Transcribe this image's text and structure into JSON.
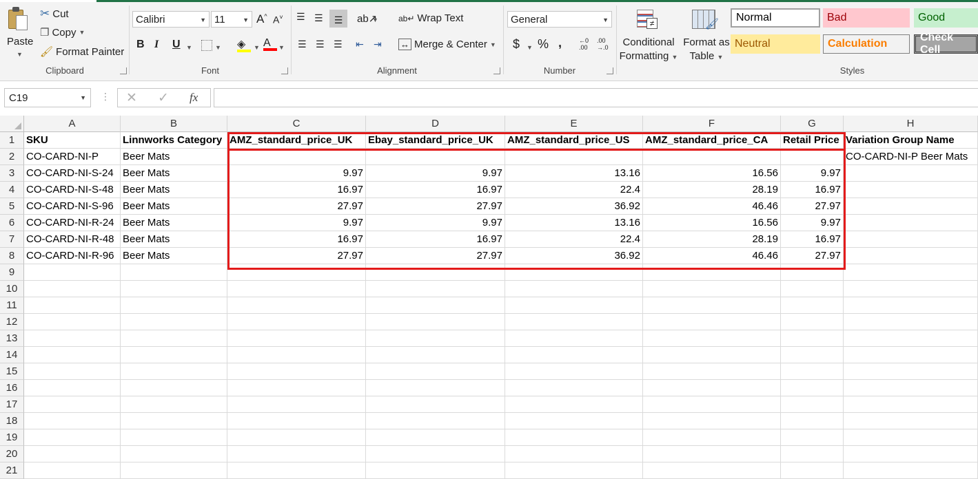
{
  "clipboard": {
    "paste": "Paste",
    "cut": "Cut",
    "copy": "Copy",
    "format_painter": "Format Painter",
    "label": "Clipboard"
  },
  "font": {
    "family": "Calibri",
    "size": "11",
    "label": "Font"
  },
  "alignment": {
    "wrap_text": "Wrap Text",
    "merge_center": "Merge & Center",
    "label": "Alignment"
  },
  "number": {
    "format": "General",
    "label": "Number"
  },
  "styles": {
    "conditional_formatting": [
      "Conditional",
      "Formatting"
    ],
    "format_as_table": [
      "Format as",
      "Table"
    ],
    "cells": [
      {
        "name": "Normal",
        "bg": "#ffffff",
        "fg": "#000000"
      },
      {
        "name": "Bad",
        "bg": "#ffc7ce",
        "fg": "#9c0006"
      },
      {
        "name": "Good",
        "bg": "#c6efce",
        "fg": "#006100"
      },
      {
        "name": "Neutral",
        "bg": "#ffeb9c",
        "fg": "#9c5700"
      },
      {
        "name": "Calculation",
        "bg": "#f2f2f2",
        "fg": "#fa7d00"
      },
      {
        "name": "Check Cell",
        "bg": "#a5a5a5",
        "fg": "#ffffff"
      }
    ],
    "label": "Styles"
  },
  "formula_bar": {
    "name_box": "C19",
    "fx": "fx",
    "formula": ""
  },
  "sheet": {
    "columns": [
      "A",
      "B",
      "C",
      "D",
      "E",
      "F",
      "G",
      "H"
    ],
    "row_numbers": [
      "1",
      "2",
      "3",
      "4",
      "5",
      "6",
      "7",
      "8",
      "9",
      "10",
      "11",
      "12",
      "13",
      "14",
      "15",
      "16",
      "17",
      "18",
      "19",
      "20",
      "21"
    ],
    "rows": [
      [
        "SKU",
        "Linnworks Category",
        "AMZ_standard_price_UK",
        "Ebay_standard_price_UK",
        "AMZ_standard_price_US",
        "AMZ_standard_price_CA",
        "Retail Price",
        "Variation Group Name"
      ],
      [
        "CO-CARD-NI-P",
        "Beer Mats",
        "",
        "",
        "",
        "",
        "",
        "CO-CARD-NI-P Beer Mats"
      ],
      [
        "CO-CARD-NI-S-24",
        "Beer Mats",
        "9.97",
        "9.97",
        "13.16",
        "16.56",
        "9.97",
        ""
      ],
      [
        "CO-CARD-NI-S-48",
        "Beer Mats",
        "16.97",
        "16.97",
        "22.4",
        "28.19",
        "16.97",
        ""
      ],
      [
        "CO-CARD-NI-S-96",
        "Beer Mats",
        "27.97",
        "27.97",
        "36.92",
        "46.46",
        "27.97",
        ""
      ],
      [
        "CO-CARD-NI-R-24",
        "Beer Mats",
        "9.97",
        "9.97",
        "13.16",
        "16.56",
        "9.97",
        ""
      ],
      [
        "CO-CARD-NI-R-48",
        "Beer Mats",
        "16.97",
        "16.97",
        "22.4",
        "28.19",
        "16.97",
        ""
      ],
      [
        "CO-CARD-NI-R-96",
        "Beer Mats",
        "27.97",
        "27.97",
        "36.92",
        "46.46",
        "27.97",
        ""
      ]
    ],
    "highlight_color": "#e31b1b"
  }
}
